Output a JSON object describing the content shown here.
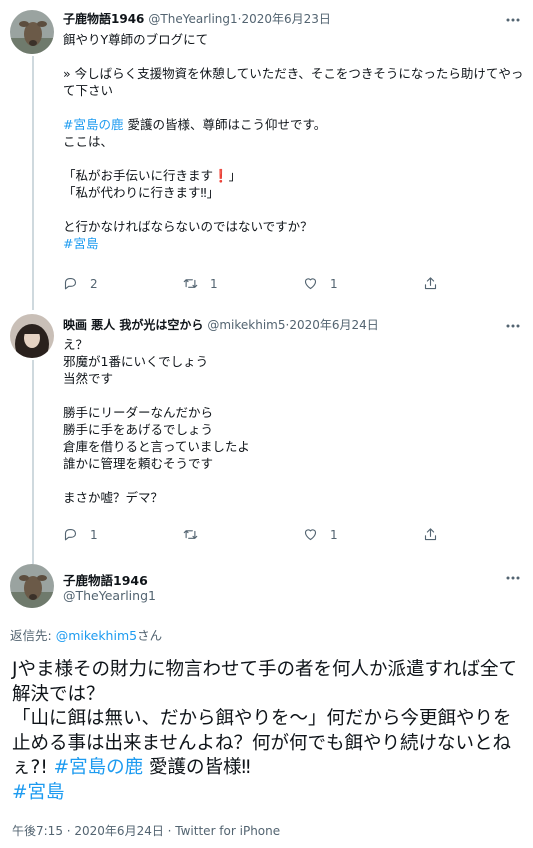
{
  "tweet1": {
    "name": "子鹿物語1946",
    "handle": "@TheYearling1",
    "sep": " · ",
    "date": "2020年6月23日",
    "body_a": "餌やりY尊師のブログにて\n\n» 今しばらく支援物資を休憩していただき、そこをつきそうになったら助けてやって下さい\n\n",
    "tag1": "#宮島の鹿",
    "body_b": " 愛護の皆様、尊師はこう仰せです。\nここは、\n\n「私がお手伝いに行きます❗」\n「私が代わりに行きます‼」\n\nと行かなければならないのではないですか？\n",
    "tag2": "#宮島",
    "replies": "2",
    "retweets": "1",
    "likes": "1"
  },
  "tweet2": {
    "name": "映画 悪人 我が光は空から",
    "handle": "@mikekhim5",
    "sep": " · ",
    "date": "2020年6月24日",
    "body": "え？\n邪魔が1番にいくでしょう\n当然です\n\n勝手にリーダーなんだから\n勝手に手をあげるでしょう\n倉庫を借りると言っていましたよ\n誰かに管理を頼むそうです\n\nまさか嘘？デマ？",
    "replies": "1",
    "retweets": "",
    "likes": "1"
  },
  "main": {
    "name": "子鹿物語1946",
    "handle": "@TheYearling1",
    "reply_prefix": "返信先: ",
    "reply_handle": "@mikekhim5",
    "reply_suffix": "さん",
    "text_a": "Jやま様その財力に物言わせて手の者を何人か派遣すれば全て解決では？\n「山に餌は無い、だから餌やりを～」何だから今更餌やりを止める事は出来ませんよね？何が何でも餌やり続けないとねぇ?! ",
    "tag1": "#宮島の鹿",
    "text_b": " 愛護の皆様‼\n",
    "tag2": "#宮島",
    "meta": "午後7:15 · 2020年6月24日 · Twitter for iPhone"
  },
  "icons": [
    "deer-avatar",
    "more-icon",
    "reply-icon",
    "retweet-icon",
    "like-icon",
    "share-icon"
  ],
  "colors": {
    "link": "#1d9bf0",
    "secondary": "#536471",
    "thread_line": "#cfd9de"
  }
}
